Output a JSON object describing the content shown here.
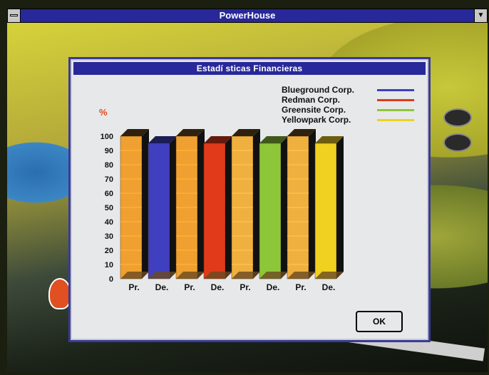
{
  "window": {
    "title": "PowerHouse"
  },
  "dialog": {
    "title": "Estadí sticas Financieras",
    "unit_symbol": "%",
    "ok_label": "OK"
  },
  "legend": [
    {
      "label": "Blueground Corp.",
      "color": "#3f3fbf"
    },
    {
      "label": "Redman Corp.",
      "color": "#e03a1a"
    },
    {
      "label": "Greensite Corp.",
      "color": "#8ec63a"
    },
    {
      "label": "Yellowpark Corp.",
      "color": "#f0d020"
    }
  ],
  "chart_data": {
    "type": "bar",
    "categories": [
      "Pr.",
      "De.",
      "Pr.",
      "De.",
      "Pr.",
      "De.",
      "Pr.",
      "De."
    ],
    "values": [
      100,
      95,
      100,
      95,
      100,
      95,
      100,
      95
    ],
    "colors": [
      "#f0a030",
      "#3f3fbf",
      "#f0a030",
      "#e03a1a",
      "#f0b040",
      "#8ec63a",
      "#f0b040",
      "#f0d020"
    ],
    "ylim": [
      0,
      100
    ],
    "yticks": [
      "0",
      "10",
      "20",
      "30",
      "40",
      "50",
      "60",
      "70",
      "80",
      "90",
      "100"
    ],
    "style": "3d"
  }
}
